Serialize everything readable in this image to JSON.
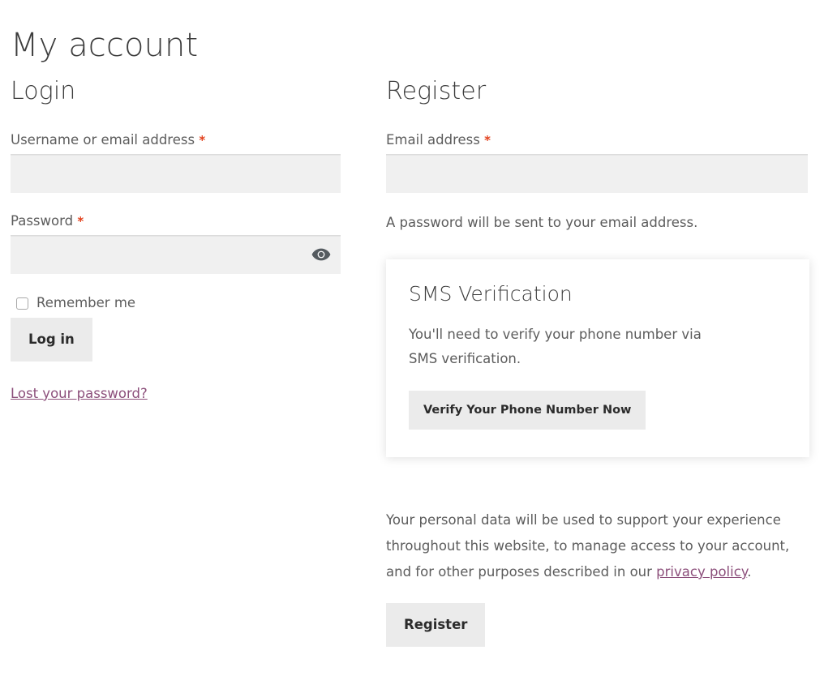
{
  "page": {
    "title": "My account"
  },
  "login": {
    "heading": "Login",
    "username": {
      "label": "Username or email address",
      "required_marker": "*",
      "value": "",
      "placeholder": ""
    },
    "password": {
      "label": "Password",
      "required_marker": "*",
      "value": "",
      "placeholder": "",
      "toggle_icon": "eye-icon"
    },
    "remember": {
      "label": "Remember me",
      "checked": false
    },
    "submit_label": "Log in",
    "lost_password_label": "Lost your password?"
  },
  "register": {
    "heading": "Register",
    "email": {
      "label": "Email address",
      "required_marker": "*",
      "value": "",
      "placeholder": ""
    },
    "password_note": "A password will be sent to your email address.",
    "sms_card": {
      "title": "SMS Verification",
      "body": "You'll need to verify your phone number via SMS verification.",
      "button_label": "Verify Your Phone Number Now"
    },
    "privacy": {
      "text_before": "Your personal data will be used to support your experience throughout this website, to manage access to your account, and for other purposes described in our ",
      "link_label": "privacy policy",
      "text_after": "."
    },
    "submit_label": "Register"
  },
  "colors": {
    "heading": "#3d3d3d",
    "body_text": "#5c5c5c",
    "required_asterisk": "#e2401c",
    "link": "#8c4f7b",
    "input_background": "#f0f0f0",
    "button_background": "#ebebeb",
    "card_background": "#ffffff",
    "page_background": "#ffffff"
  }
}
